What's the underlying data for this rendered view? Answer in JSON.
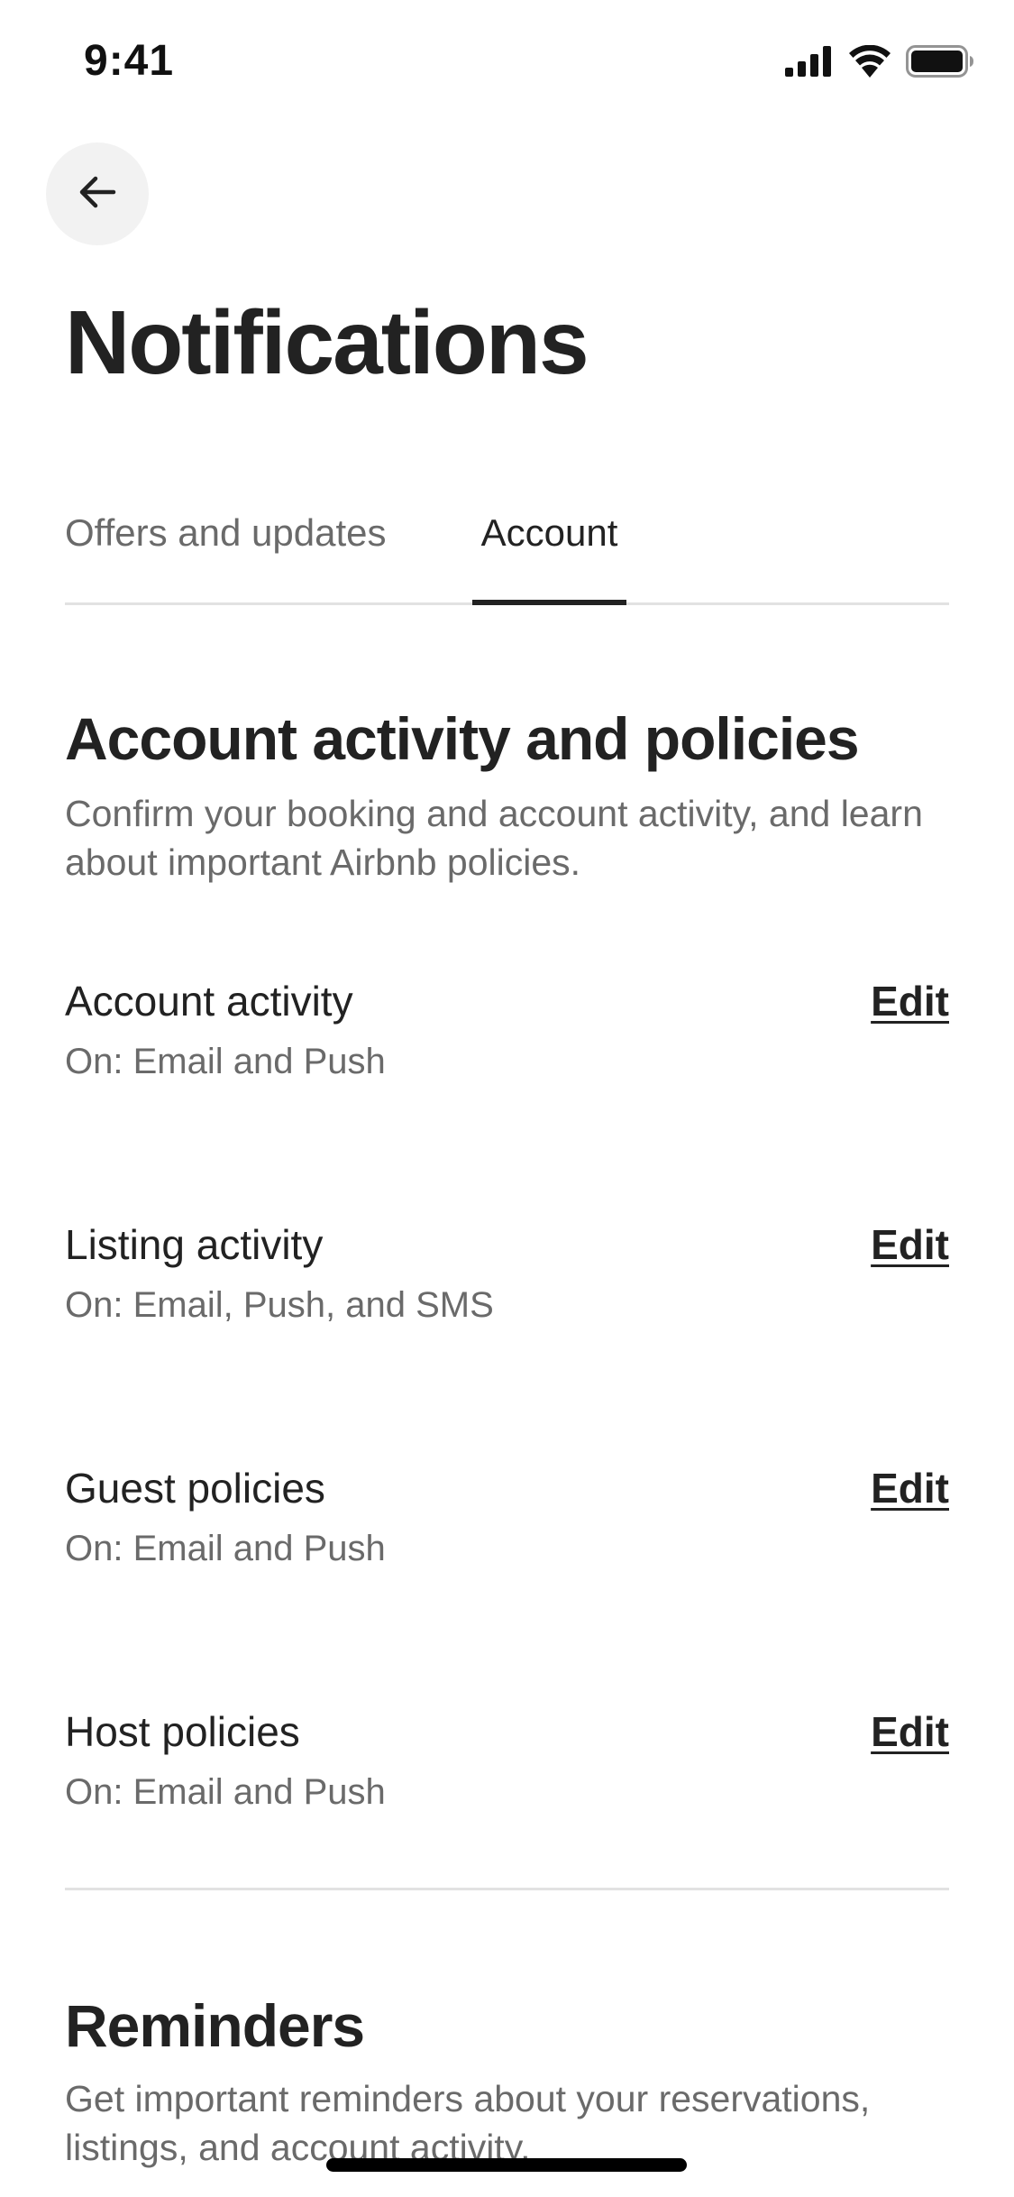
{
  "status_bar": {
    "time": "9:41",
    "icons": [
      "cellular-signal-icon",
      "wifi-icon",
      "battery-icon"
    ]
  },
  "header": {
    "back_icon": "arrow-left-icon",
    "title": "Notifications"
  },
  "tabs": [
    {
      "label": "Offers and updates",
      "selected": false
    },
    {
      "label": "Account",
      "selected": true
    }
  ],
  "sections": [
    {
      "title": "Account activity and policies",
      "description": "Confirm your booking and account activity, and learn about important Airbnb policies.",
      "items": [
        {
          "title": "Account activity",
          "status": "On: Email and Push",
          "action": "Edit"
        },
        {
          "title": "Listing activity",
          "status": "On: Email, Push, and SMS",
          "action": "Edit"
        },
        {
          "title": "Guest policies",
          "status": "On: Email and Push",
          "action": "Edit"
        },
        {
          "title": "Host policies",
          "status": "On: Email and Push",
          "action": "Edit"
        }
      ]
    },
    {
      "title": "Reminders",
      "description": "Get important reminders about your reservations, listings, and account activity."
    }
  ],
  "colors": {
    "primary_text": "#222222",
    "secondary_text": "#6a6a6a",
    "divider": "#e2e2e2",
    "back_button_bg": "#f2f2f2"
  }
}
